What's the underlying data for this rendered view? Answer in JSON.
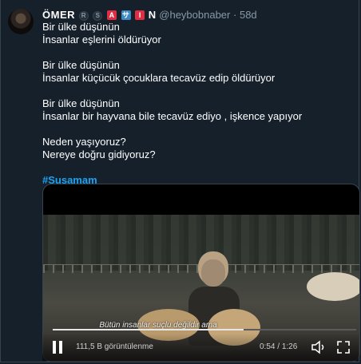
{
  "tweet": {
    "name_parts": [
      "ÖMER",
      "A",
      "N"
    ],
    "badge_letters": [
      "R",
      "S",
      "A",
      "サ",
      "I"
    ],
    "handle": "@heybobnaber",
    "separator": "·",
    "time": "58d",
    "paragraphs": [
      [
        "Bir ülke düşünün",
        "İnsanlar eşlerini öldürüyor"
      ],
      [
        "Bir ülke düşünün",
        "İnsanlar küçücük çocuklara tecavüz edip öldürüyor"
      ],
      [
        "Bir ülke düşünün",
        "İnsanlar bir hayvana bile tecavüz ediyo , işkence yapıyor"
      ],
      [
        "Neden yaşıyoruz?",
        "Nereye doğru gidiyoruz?"
      ]
    ],
    "hashtag": "#Susamam"
  },
  "video": {
    "subtitle": "Bütün insanlar suçlu değildir ama",
    "views": "111,5 B görüntülenme",
    "current_time": "0:54",
    "duration": "1:26",
    "time_separator": " / ",
    "progress_fraction": 0.63,
    "icons": [
      "pause-icon",
      "speaker-icon",
      "fullscreen-icon"
    ]
  },
  "colors": {
    "background": "#15202b",
    "accent": "#1da1f2",
    "secondary_text": "#8899a6"
  }
}
